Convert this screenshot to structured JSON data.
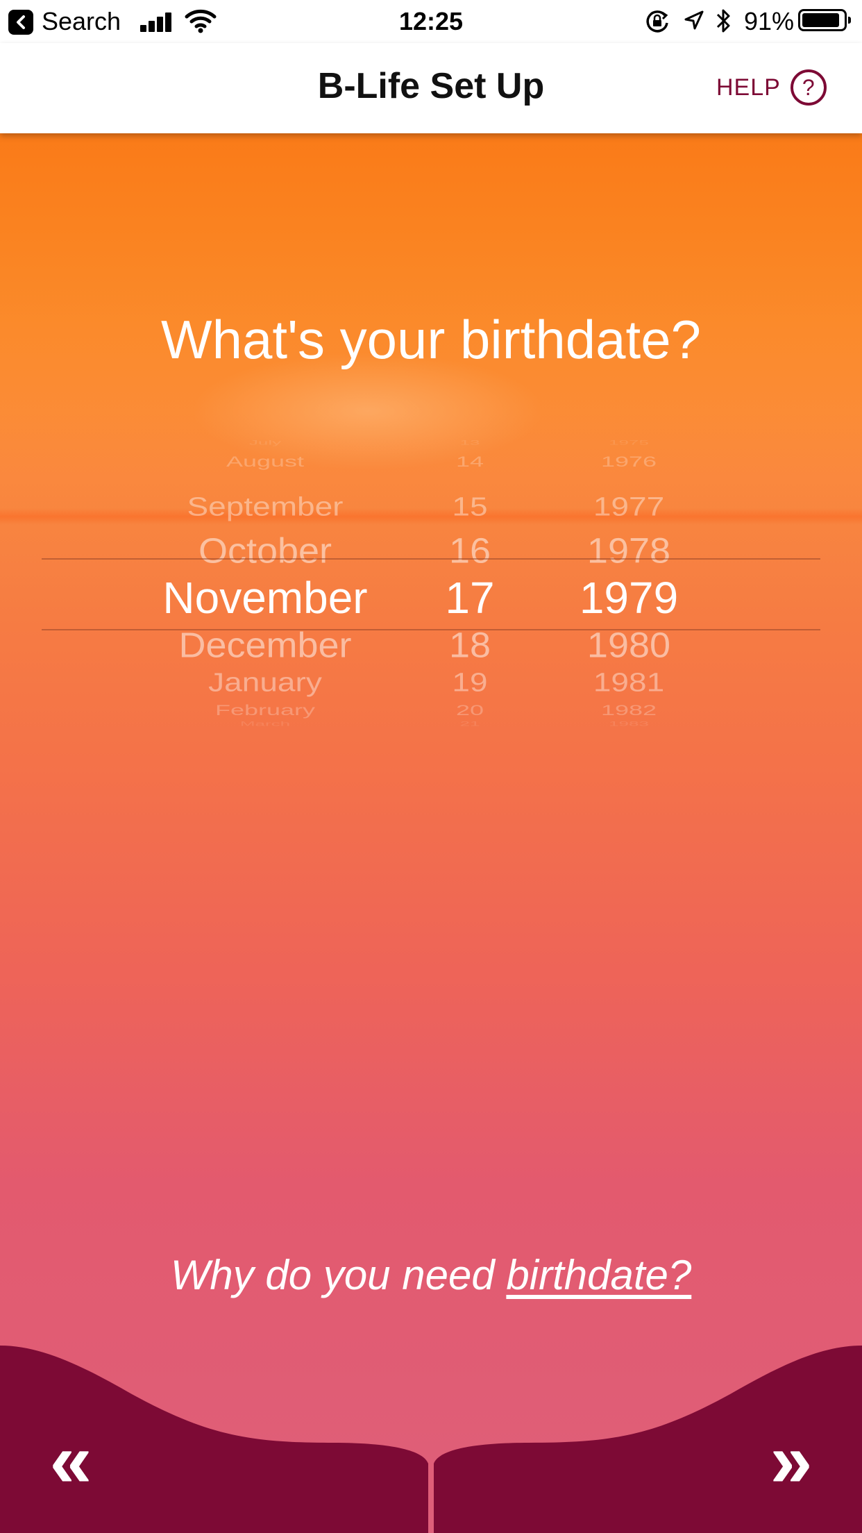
{
  "status_bar": {
    "back_app": "Search",
    "time": "12:25",
    "battery_percent": "91%",
    "battery_level": 0.91
  },
  "nav": {
    "title": "B-Life Set Up",
    "help_label": "HELP",
    "help_icon_glyph": "?"
  },
  "question": "What's your birthdate?",
  "picker": {
    "rows_above": [
      {
        "month": "July",
        "day": "13",
        "year": "1975"
      },
      {
        "month": "August",
        "day": "14",
        "year": "1976"
      },
      {
        "month": "September",
        "day": "15",
        "year": "1977"
      },
      {
        "month": "October",
        "day": "16",
        "year": "1978"
      }
    ],
    "selected": {
      "month": "November",
      "day": "17",
      "year": "1979"
    },
    "rows_below": [
      {
        "month": "December",
        "day": "18",
        "year": "1980"
      },
      {
        "month": "January",
        "day": "19",
        "year": "1981"
      },
      {
        "month": "February",
        "day": "20",
        "year": "1982"
      },
      {
        "month": "March",
        "day": "21",
        "year": "1983"
      }
    ]
  },
  "why": {
    "prefix": "Why do you need ",
    "link": "birthdate?"
  },
  "footer": {
    "back_glyph": "«",
    "next_glyph": "»"
  },
  "colors": {
    "brand_maroon": "#7d0a35",
    "gradient_top": "#fb8a1e",
    "gradient_bottom": "#de5f7a"
  }
}
